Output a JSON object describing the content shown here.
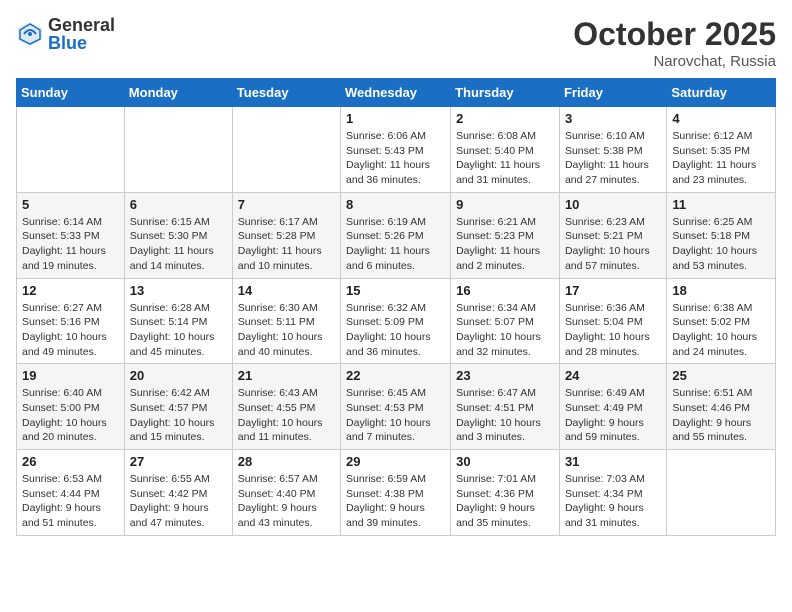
{
  "logo": {
    "general": "General",
    "blue": "Blue"
  },
  "title": "October 2025",
  "location": "Narovchat, Russia",
  "days_header": [
    "Sunday",
    "Monday",
    "Tuesday",
    "Wednesday",
    "Thursday",
    "Friday",
    "Saturday"
  ],
  "weeks": [
    [
      {
        "day": "",
        "info": ""
      },
      {
        "day": "",
        "info": ""
      },
      {
        "day": "",
        "info": ""
      },
      {
        "day": "1",
        "info": "Sunrise: 6:06 AM\nSunset: 5:43 PM\nDaylight: 11 hours\nand 36 minutes."
      },
      {
        "day": "2",
        "info": "Sunrise: 6:08 AM\nSunset: 5:40 PM\nDaylight: 11 hours\nand 31 minutes."
      },
      {
        "day": "3",
        "info": "Sunrise: 6:10 AM\nSunset: 5:38 PM\nDaylight: 11 hours\nand 27 minutes."
      },
      {
        "day": "4",
        "info": "Sunrise: 6:12 AM\nSunset: 5:35 PM\nDaylight: 11 hours\nand 23 minutes."
      }
    ],
    [
      {
        "day": "5",
        "info": "Sunrise: 6:14 AM\nSunset: 5:33 PM\nDaylight: 11 hours\nand 19 minutes."
      },
      {
        "day": "6",
        "info": "Sunrise: 6:15 AM\nSunset: 5:30 PM\nDaylight: 11 hours\nand 14 minutes."
      },
      {
        "day": "7",
        "info": "Sunrise: 6:17 AM\nSunset: 5:28 PM\nDaylight: 11 hours\nand 10 minutes."
      },
      {
        "day": "8",
        "info": "Sunrise: 6:19 AM\nSunset: 5:26 PM\nDaylight: 11 hours\nand 6 minutes."
      },
      {
        "day": "9",
        "info": "Sunrise: 6:21 AM\nSunset: 5:23 PM\nDaylight: 11 hours\nand 2 minutes."
      },
      {
        "day": "10",
        "info": "Sunrise: 6:23 AM\nSunset: 5:21 PM\nDaylight: 10 hours\nand 57 minutes."
      },
      {
        "day": "11",
        "info": "Sunrise: 6:25 AM\nSunset: 5:18 PM\nDaylight: 10 hours\nand 53 minutes."
      }
    ],
    [
      {
        "day": "12",
        "info": "Sunrise: 6:27 AM\nSunset: 5:16 PM\nDaylight: 10 hours\nand 49 minutes."
      },
      {
        "day": "13",
        "info": "Sunrise: 6:28 AM\nSunset: 5:14 PM\nDaylight: 10 hours\nand 45 minutes."
      },
      {
        "day": "14",
        "info": "Sunrise: 6:30 AM\nSunset: 5:11 PM\nDaylight: 10 hours\nand 40 minutes."
      },
      {
        "day": "15",
        "info": "Sunrise: 6:32 AM\nSunset: 5:09 PM\nDaylight: 10 hours\nand 36 minutes."
      },
      {
        "day": "16",
        "info": "Sunrise: 6:34 AM\nSunset: 5:07 PM\nDaylight: 10 hours\nand 32 minutes."
      },
      {
        "day": "17",
        "info": "Sunrise: 6:36 AM\nSunset: 5:04 PM\nDaylight: 10 hours\nand 28 minutes."
      },
      {
        "day": "18",
        "info": "Sunrise: 6:38 AM\nSunset: 5:02 PM\nDaylight: 10 hours\nand 24 minutes."
      }
    ],
    [
      {
        "day": "19",
        "info": "Sunrise: 6:40 AM\nSunset: 5:00 PM\nDaylight: 10 hours\nand 20 minutes."
      },
      {
        "day": "20",
        "info": "Sunrise: 6:42 AM\nSunset: 4:57 PM\nDaylight: 10 hours\nand 15 minutes."
      },
      {
        "day": "21",
        "info": "Sunrise: 6:43 AM\nSunset: 4:55 PM\nDaylight: 10 hours\nand 11 minutes."
      },
      {
        "day": "22",
        "info": "Sunrise: 6:45 AM\nSunset: 4:53 PM\nDaylight: 10 hours\nand 7 minutes."
      },
      {
        "day": "23",
        "info": "Sunrise: 6:47 AM\nSunset: 4:51 PM\nDaylight: 10 hours\nand 3 minutes."
      },
      {
        "day": "24",
        "info": "Sunrise: 6:49 AM\nSunset: 4:49 PM\nDaylight: 9 hours\nand 59 minutes."
      },
      {
        "day": "25",
        "info": "Sunrise: 6:51 AM\nSunset: 4:46 PM\nDaylight: 9 hours\nand 55 minutes."
      }
    ],
    [
      {
        "day": "26",
        "info": "Sunrise: 6:53 AM\nSunset: 4:44 PM\nDaylight: 9 hours\nand 51 minutes."
      },
      {
        "day": "27",
        "info": "Sunrise: 6:55 AM\nSunset: 4:42 PM\nDaylight: 9 hours\nand 47 minutes."
      },
      {
        "day": "28",
        "info": "Sunrise: 6:57 AM\nSunset: 4:40 PM\nDaylight: 9 hours\nand 43 minutes."
      },
      {
        "day": "29",
        "info": "Sunrise: 6:59 AM\nSunset: 4:38 PM\nDaylight: 9 hours\nand 39 minutes."
      },
      {
        "day": "30",
        "info": "Sunrise: 7:01 AM\nSunset: 4:36 PM\nDaylight: 9 hours\nand 35 minutes."
      },
      {
        "day": "31",
        "info": "Sunrise: 7:03 AM\nSunset: 4:34 PM\nDaylight: 9 hours\nand 31 minutes."
      },
      {
        "day": "",
        "info": ""
      }
    ]
  ]
}
